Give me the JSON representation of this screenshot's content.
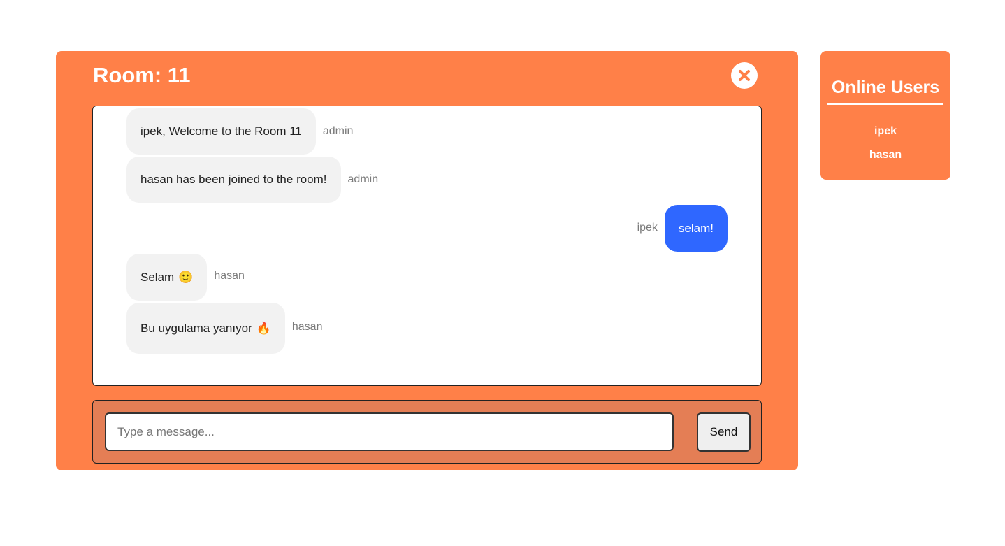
{
  "room": {
    "title": "Room: 11"
  },
  "messages": [
    {
      "text": "ipek, Welcome to the Room 11",
      "sender": "admin",
      "own": false,
      "emoji": ""
    },
    {
      "text": "hasan has been joined to the room!",
      "sender": "admin",
      "own": false,
      "emoji": ""
    },
    {
      "text": "selam!",
      "sender": "ipek",
      "own": true,
      "emoji": ""
    },
    {
      "text": "Selam",
      "sender": "hasan",
      "own": false,
      "emoji": "🙂"
    },
    {
      "text": "Bu uygulama yanıyor",
      "sender": "hasan",
      "own": false,
      "emoji": "🔥"
    }
  ],
  "composer": {
    "placeholder": "Type a message...",
    "value": "",
    "send_label": "Send"
  },
  "online": {
    "title": "Online Users",
    "users": [
      "ipek",
      "hasan"
    ]
  },
  "colors": {
    "panel": "#ff8048",
    "own_bubble": "#2f67ff",
    "other_bubble": "#f2f2f2",
    "composer_bg": "#e47e55"
  },
  "icons": {
    "close": "close-x-icon"
  }
}
